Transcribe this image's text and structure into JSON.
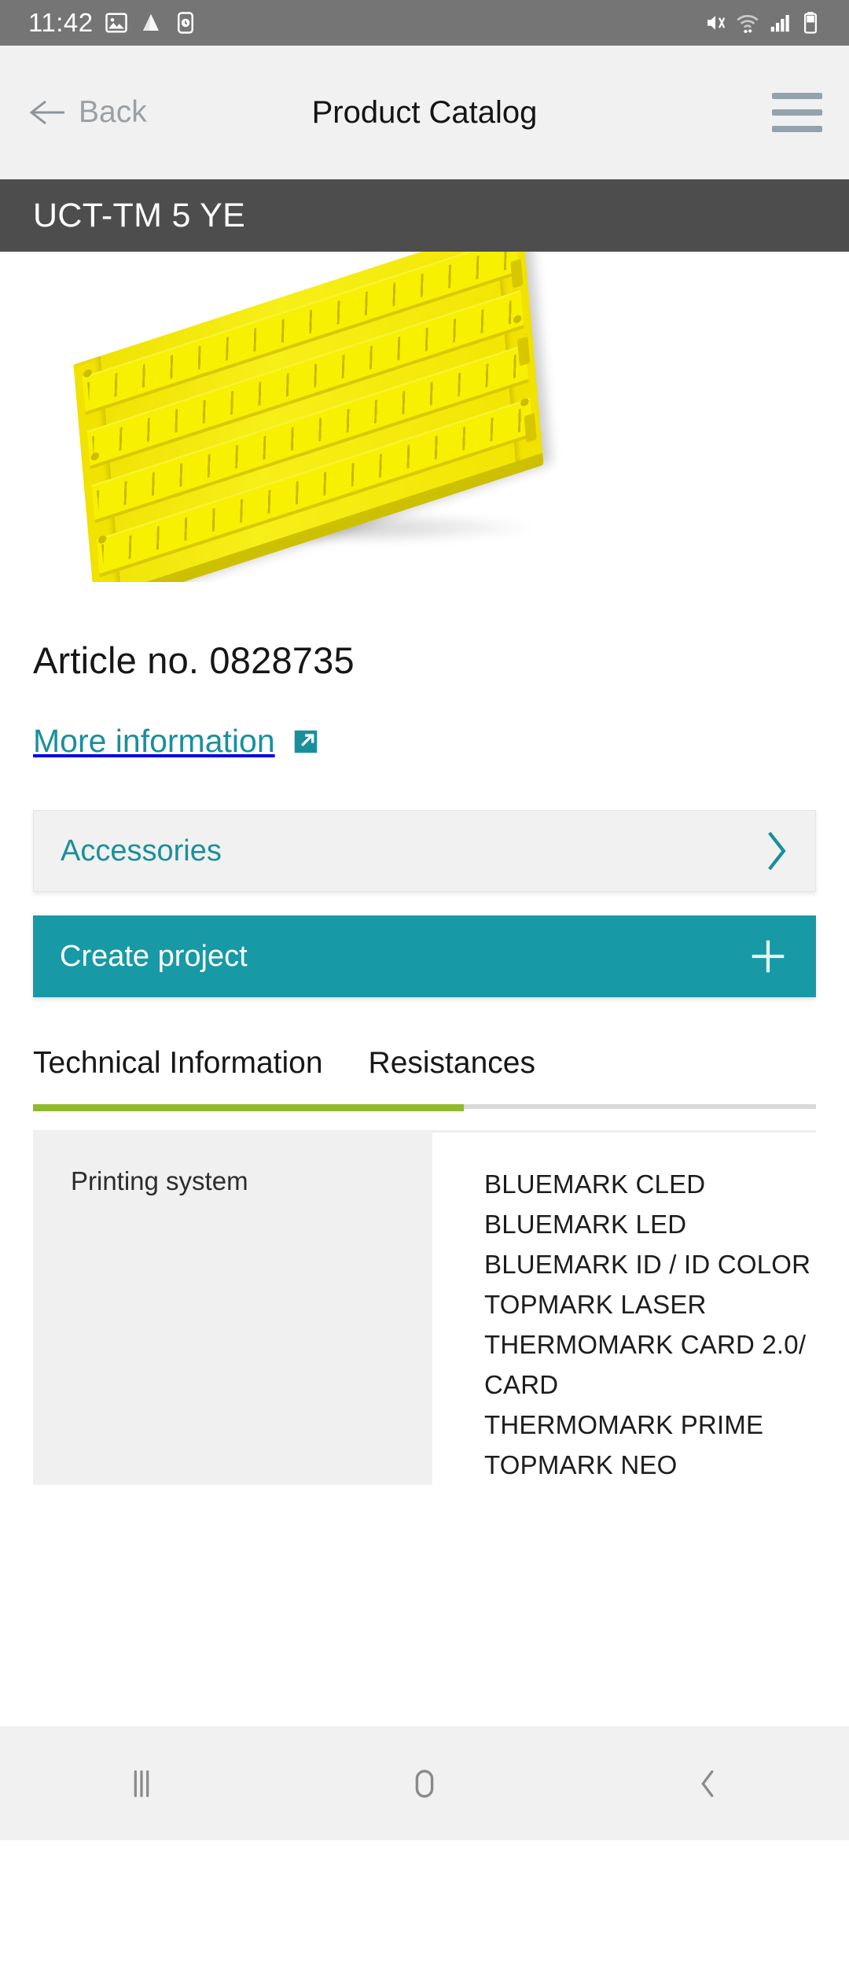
{
  "status_bar": {
    "time": "11:42",
    "left_icons": [
      "image-icon",
      "drive-icon",
      "clock-icon"
    ],
    "right_icons": [
      "mute-icon",
      "wifi-icon",
      "signal-icon",
      "battery-icon"
    ],
    "background": "#757575"
  },
  "app_bar": {
    "back_label": "Back",
    "title": "Product Catalog",
    "menu_icon": "hamburger-menu-icon",
    "background": "#f1f1f1"
  },
  "product_bar": {
    "title": "UCT-TM 5 YE",
    "background": "#4d4d4d"
  },
  "hero": {
    "image_alt": "yellow marker card product photo",
    "product_color": "#f2e500"
  },
  "details": {
    "article_label": "Article no. 0828735",
    "more_information": {
      "label": "More information",
      "icon": "external-link-icon",
      "color": "#1a8f9c"
    }
  },
  "actions": {
    "accessories": {
      "label": "Accessories",
      "icon": "chevron-right-icon",
      "color": "#1a8f9c"
    },
    "create_project": {
      "label": "Create project",
      "icon": "plus-icon",
      "background": "#1799a6"
    }
  },
  "tabs": {
    "items": [
      {
        "label": "Technical Information",
        "active": true
      },
      {
        "label": "Resistances",
        "active": false
      }
    ],
    "active_color": "#91ba2b"
  },
  "spec_table": {
    "rows": [
      {
        "label": "Printing system",
        "values": [
          "BLUEMARK CLED",
          "BLUEMARK LED",
          "BLUEMARK ID / ID COLOR",
          "TOPMARK LASER",
          "THERMOMARK CARD 2.0/ CARD",
          "THERMOMARK PRIME",
          "TOPMARK NEO"
        ]
      }
    ]
  },
  "nav_bar": {
    "recents": "recents-icon",
    "home": "home-icon",
    "back": "back-icon",
    "background": "#f1f1f1"
  }
}
